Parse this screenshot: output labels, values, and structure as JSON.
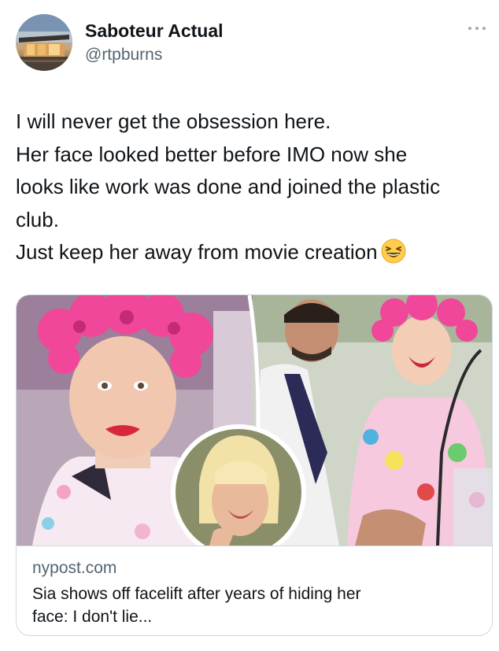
{
  "tweet": {
    "author": {
      "display_name": "Saboteur Actual",
      "handle": "@rtpburns",
      "avatar_icon": "avatar-photo-modern-house"
    },
    "more_icon": "more-horizontal-icon",
    "text_lines": [
      "I will never get the obsession here.",
      "Her face looked better before IMO now she",
      "looks like work was done and joined the plastic",
      "club.",
      "Just keep her away from movie creation"
    ],
    "emoji_icon": "grinning-squinting-face-icon",
    "link_card": {
      "image_icon": "article-photo-collage",
      "domain": "nypost.com",
      "title_lines": [
        "Sia shows off facelift after years of hiding her",
        "face: I don't lie..."
      ]
    }
  },
  "colors": {
    "text_primary": "#0f1419",
    "text_secondary": "#536471",
    "card_border": "#cfd9de",
    "pink_bow": "#f0479a"
  }
}
